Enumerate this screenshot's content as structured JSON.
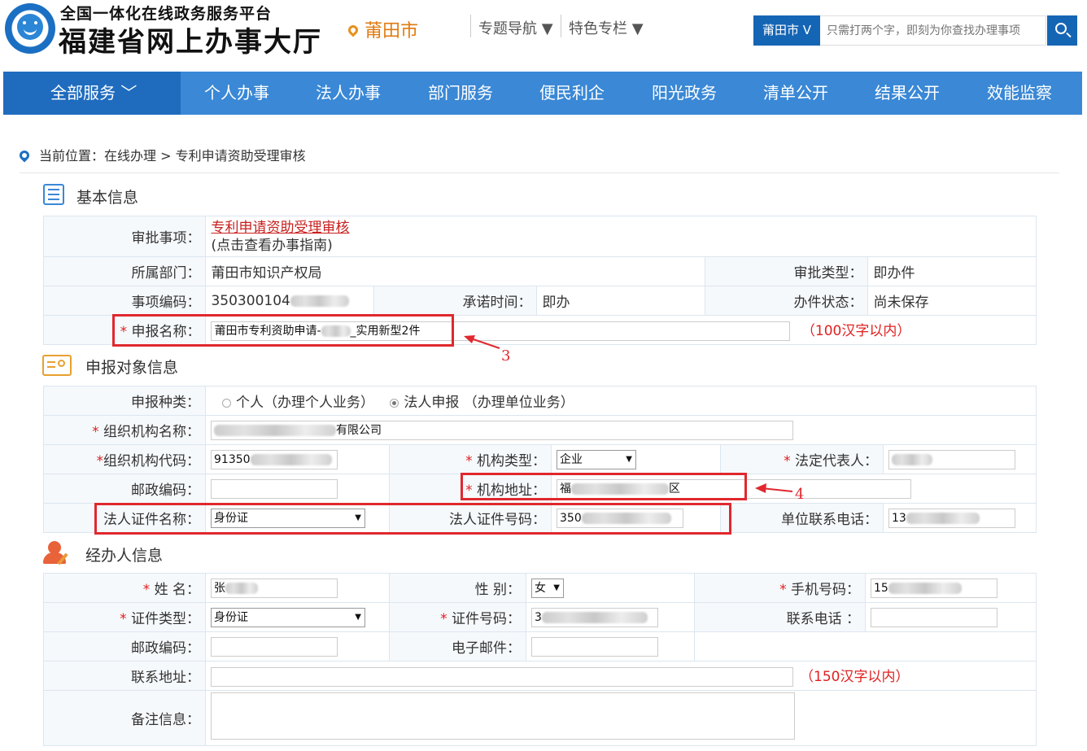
{
  "header": {
    "platform_subtitle": "全国一体化在线政务服务平台",
    "platform_title": "福建省网上办事大厅",
    "city": "莆田市",
    "topnav": [
      "专题导航 ▼",
      "特色专栏 ▼"
    ],
    "search_city": "莆田市 V",
    "search_placeholder": "只需打两个字，即刻为你查找办理事项"
  },
  "nav": {
    "all": "全部服务 ﹀",
    "items": [
      "个人办事",
      "法人办事",
      "部门服务",
      "便民利企",
      "阳光政务",
      "清单公开",
      "结果公开",
      "效能监察"
    ]
  },
  "breadcrumb": "当前位置：在线办理 > 专利申请资助受理审核",
  "basic": {
    "title": "基本信息",
    "approval_label": "审批事项：",
    "approval_link": "专利申请资助受理审核",
    "approval_note": "(点击查看办事指南)",
    "dept_label": "所属部门：",
    "dept_value": "莆田市知识产权局",
    "type_label": "审批类型：",
    "type_value": "即办件",
    "code_label": "事项编码：",
    "code_value": "350300104",
    "promise_label": "承诺时间：",
    "promise_value": "即办",
    "status_label": "办件状态：",
    "status_value": "尚未保存",
    "name_label": "申报名称：",
    "name_value_a": "莆田市专利资助申请-",
    "name_value_b": "_实用新型2件",
    "name_hint": "（100汉字以内）"
  },
  "applicant": {
    "title": "申报对象信息",
    "kind_label": "申报种类：",
    "kind_personal": "个人（办理个人业务）",
    "kind_legal": "法人申报 （办理单位业务）",
    "org_name_label": "组织机构名称：",
    "org_name_suffix": "有限公司",
    "org_code_label": "组织机构代码：",
    "org_code_value": "91350",
    "org_type_label": "机构类型：",
    "org_type_value": "企业",
    "legal_rep_label": "法定代表人：",
    "postcode_label": "邮政编码：",
    "address_label": "机构地址：",
    "address_a": "福",
    "address_b": "区",
    "cert_name_label": "法人证件名称：",
    "cert_name_value": "身份证",
    "cert_no_label": "法人证件号码：",
    "cert_no_value": "350",
    "phone_label": "单位联系电话：",
    "phone_value": "13"
  },
  "handler": {
    "title": "经办人信息",
    "name_label": "姓 名：",
    "name_value": "张",
    "gender_label": "性 别：",
    "gender_value": "女",
    "mobile_label": "手机号码：",
    "mobile_value": "15",
    "id_type_label": "证件类型：",
    "id_type_value": "身份证",
    "id_no_label": "证件号码：",
    "id_no_value": "3",
    "tel_label": "联系电话 ：",
    "postcode_label": "邮政编码：",
    "email_label": "电子邮件：",
    "address_label": "联系地址：",
    "address_hint": "（150汉字以内）",
    "remark_label": "备注信息："
  },
  "annotations": [
    "3",
    "4"
  ]
}
